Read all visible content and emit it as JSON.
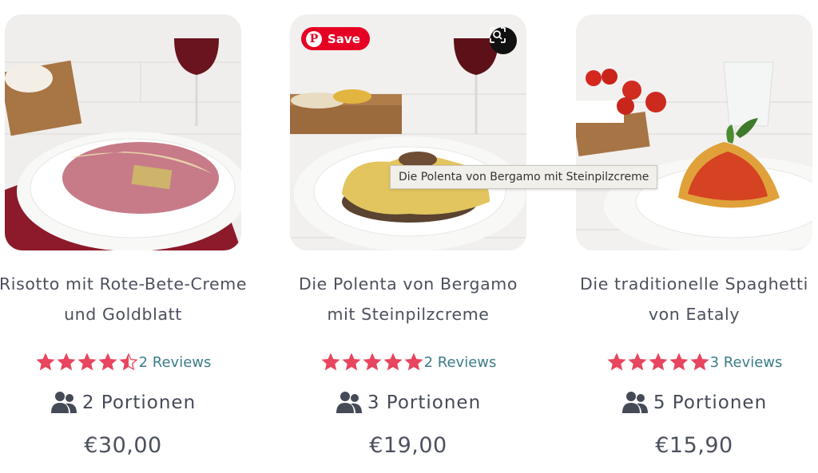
{
  "colors": {
    "star": "#e8455e",
    "reviews_link": "#3c7d88",
    "text": "#4b505c",
    "pinterest": "#e60023"
  },
  "cards": [
    {
      "title_line1": "Risotto mit Rote-Bete-Creme",
      "title_line2": "und Goldblatt",
      "rating": 4.5,
      "reviews": "2 Reviews",
      "portions": "2 Portionen",
      "price": "€30,00"
    },
    {
      "title_line1": "Die Polenta von Bergamo",
      "title_line2": "mit Steinpilzcreme",
      "rating": 5,
      "reviews": "2 Reviews",
      "portions": "3 Portionen",
      "price": "€19,00"
    },
    {
      "title_line1": "Die traditionelle Spaghetti",
      "title_line2": "von Eataly",
      "rating": 5,
      "reviews": "3 Reviews",
      "portions": "5 Portionen",
      "price": "€15,90"
    }
  ],
  "overlay": {
    "save_label": "Save",
    "pin_glyph": "P",
    "tooltip": "Die Polenta von Bergamo mit Steinpilzcreme"
  },
  "icons": {
    "portions": "users-icon",
    "visual_search": "visual-search-icon",
    "pinterest": "pinterest-icon"
  }
}
